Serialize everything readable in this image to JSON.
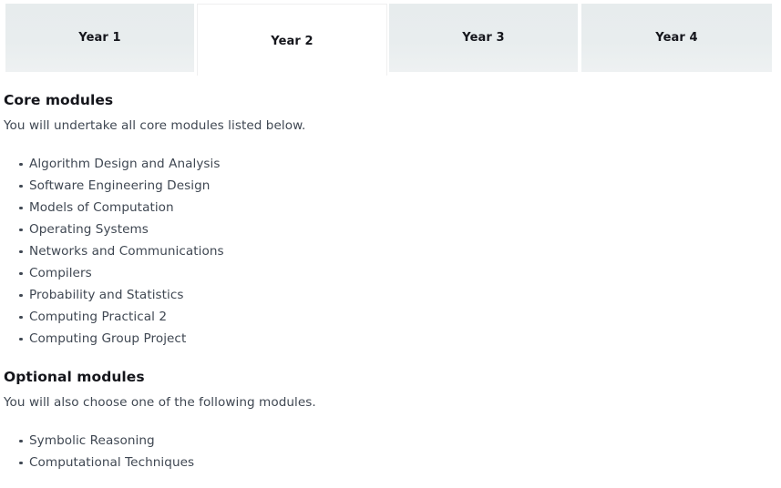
{
  "tabs": {
    "items": [
      {
        "label": "Year 1",
        "active": false
      },
      {
        "label": "Year 2",
        "active": true
      },
      {
        "label": "Year 3",
        "active": false
      },
      {
        "label": "Year 4",
        "active": false
      }
    ]
  },
  "sections": {
    "core": {
      "heading": "Core modules",
      "intro": "You will undertake all core modules listed below.",
      "modules": [
        "Algorithm Design and Analysis",
        "Software Engineering Design",
        "Models of Computation",
        "Operating Systems",
        "Networks and Communications",
        "Compilers",
        "Probability and Statistics",
        "Computing Practical 2",
        "Computing Group Project"
      ]
    },
    "optional": {
      "heading": "Optional modules",
      "intro": "You will also choose one of the following modules.",
      "modules": [
        "Symbolic Reasoning",
        "Computational Techniques"
      ]
    }
  },
  "colors": {
    "tab_inactive_bg": "#e8edee",
    "tab_active_bg": "#ffffff",
    "tab_active_border": "#efeff0",
    "heading_text": "#14151b",
    "body_text": "#3f4752",
    "page_bg": "#ffffff"
  }
}
